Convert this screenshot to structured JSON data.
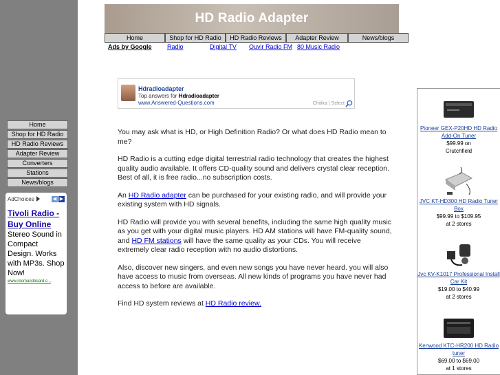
{
  "header": {
    "title": "HD Radio Adapter"
  },
  "top_nav": [
    {
      "label": "Home"
    },
    {
      "label": "Shop for HD Radio"
    },
    {
      "label": "HD Radio Reviews"
    },
    {
      "label": "Adapter Review"
    },
    {
      "label": "News/blogs"
    }
  ],
  "ad_links": {
    "ads_by": "Ads by Google",
    "links": [
      "Radio",
      "Digital TV",
      "Ouvir Radio FM",
      "80 Music Radio"
    ]
  },
  "left_nav": [
    {
      "label": "Home"
    },
    {
      "label": "Shop for HD Radio"
    },
    {
      "label": "HD Radio Reviews"
    },
    {
      "label": "Adapter Review"
    },
    {
      "label": "Converters"
    },
    {
      "label": "Stations"
    },
    {
      "label": "News/blogs"
    }
  ],
  "left_ad": {
    "adchoices": "AdChoices",
    "title": "Tivoli Radio - Buy Online",
    "description": "Stereo Sound in Compact Design. Works with MP3s. Shop Now!",
    "url": "www.roomandboard.c..."
  },
  "search_widget": {
    "title": "Hdradioadapter",
    "subtitle_prefix": "Top answers for ",
    "subtitle_bold": "Hdradioadapter",
    "url": "www.Answered-Questions.com",
    "footer": "Chitika | Select"
  },
  "content": {
    "p1": "You may ask what is HD, or High Definition Radio? Or what does HD Radio mean to me?",
    "p2": "HD Radio is a cutting edge digital terrestrial radio technology that creates the highest quality audio available. It offers CD-quality sound and delivers crystal clear reception. Best of all, it is free radio...no subscription costs.",
    "p3_pre": "An ",
    "p3_link": "HD Radio adapter",
    "p3_post": " can be purchased for your existing radio, and will provide your existing system with HD signals.",
    "p4_pre": "HD Radio will provide you with  several benefits, including the same high quality music as you get with your digital music players. HD AM stations will have FM-quality sound, and ",
    "p4_link": "HD FM stations",
    "p4_post": " will have the same quality as your CDs. You will receive extremely clear radio reception with no audio distortions.",
    "p5": "Also, discover new singers, and even new songs you have never heard. you will also have access to music from overseas. All new kinds of programs you have never had access to before are available.",
    "p6_pre": "Find HD system reviews at ",
    "p6_link": "HD Radio review."
  },
  "products": [
    {
      "name": "Pioneer GEX-P20HD HD Radio Add-On Tuner",
      "price": "$99.99 on",
      "store": "Crutchfield",
      "icon": "car-tuner-icon"
    },
    {
      "name": "JVC KT-HD300 HD Radio Tuner Box",
      "price": "$99.99 to $109.95",
      "store": "at 2 stores",
      "icon": "tuner-box-icon"
    },
    {
      "name": "Jvc KV-K1017 Professional Install Car Kit",
      "price": "$19.00 to $40.99",
      "store": "at 2 stores",
      "icon": "car-kit-icon"
    },
    {
      "name": "Kenwood KTC-HR200 HD Radio tuner",
      "price": "$69.00 to $69.00",
      "store": "at 1 stores",
      "icon": "kenwood-tuner-icon"
    }
  ]
}
